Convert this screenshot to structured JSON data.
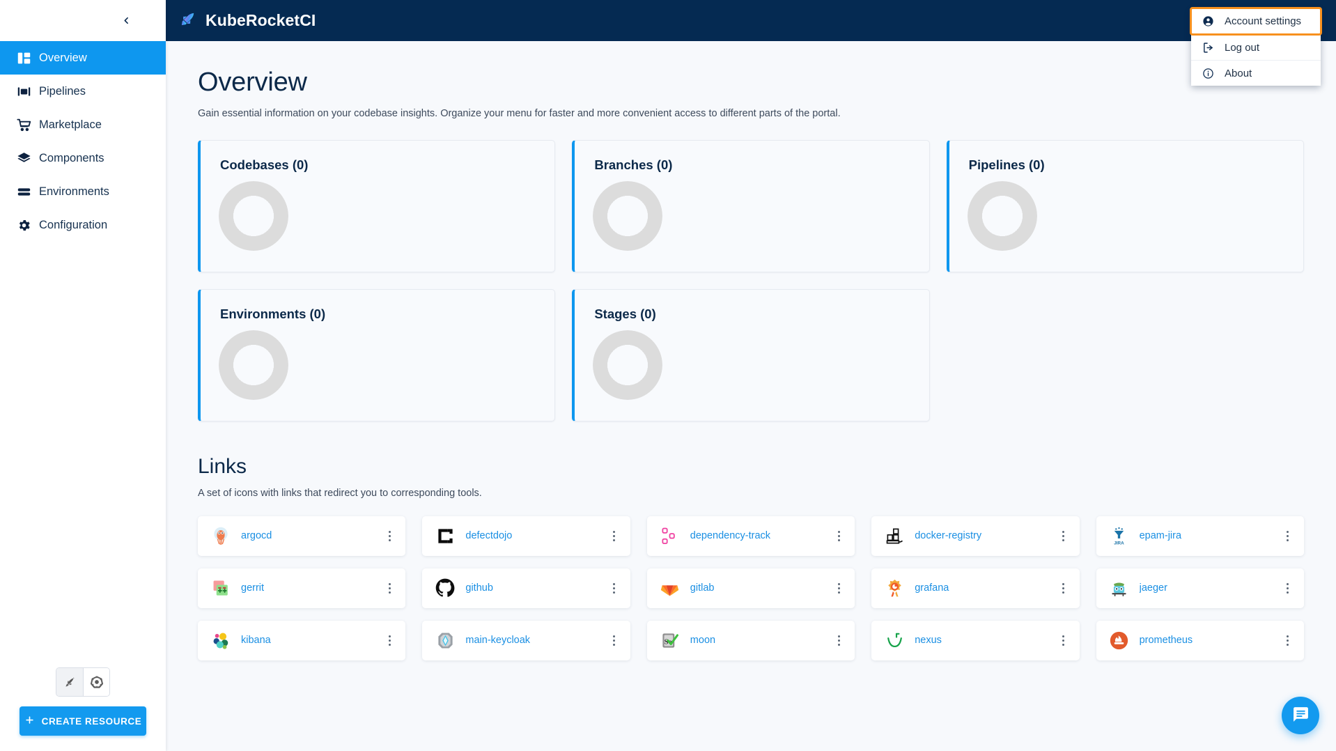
{
  "sidebar": {
    "collapse_icon": "chevron-left-icon",
    "items": [
      {
        "label": "Overview",
        "icon": "dashboard-icon",
        "active": true
      },
      {
        "label": "Pipelines",
        "icon": "pipelines-icon",
        "active": false
      },
      {
        "label": "Marketplace",
        "icon": "cart-icon",
        "active": false
      },
      {
        "label": "Components",
        "icon": "layers-icon",
        "active": false
      },
      {
        "label": "Environments",
        "icon": "stack-icon",
        "active": false
      },
      {
        "label": "Configuration",
        "icon": "gear-icon",
        "active": false
      }
    ],
    "mode_toggle": [
      {
        "icon": "rocket-icon",
        "selected": true
      },
      {
        "icon": "kubernetes-icon",
        "selected": false
      }
    ],
    "create_button": {
      "label": "CREATE RESOURCE",
      "icon": "plus-icon"
    }
  },
  "topbar": {
    "brand": "KubeRocketCI",
    "brand_icon": "rocket-feather-logo",
    "account_menu": [
      {
        "label": "Account settings",
        "icon": "account-circle-icon",
        "highlighted": true
      },
      {
        "label": "Log out",
        "icon": "logout-icon",
        "highlighted": false
      },
      {
        "label": "About",
        "icon": "info-icon",
        "highlighted": false
      }
    ]
  },
  "main": {
    "title": "Overview",
    "subtitle": "Gain essential information on your codebase insights. Organize your menu for faster and more convenient access to different parts of the portal.",
    "stat_cards": [
      {
        "title": "Codebases (0)",
        "count": 0
      },
      {
        "title": "Branches (0)",
        "count": 0
      },
      {
        "title": "Pipelines (0)",
        "count": 0
      },
      {
        "title": "Environments (0)",
        "count": 0
      },
      {
        "title": "Stages (0)",
        "count": 0
      }
    ],
    "links_section": {
      "title": "Links",
      "subtitle": "A set of icons with links that redirect you to corresponding tools.",
      "kebab_icon": "more-vertical-icon",
      "items": [
        {
          "label": "argocd",
          "icon": "argocd-icon"
        },
        {
          "label": "defectdojo",
          "icon": "defectdojo-icon"
        },
        {
          "label": "dependency-track",
          "icon": "dependency-track-icon"
        },
        {
          "label": "docker-registry",
          "icon": "docker-registry-icon"
        },
        {
          "label": "epam-jira",
          "icon": "jira-icon"
        },
        {
          "label": "gerrit",
          "icon": "gerrit-icon"
        },
        {
          "label": "github",
          "icon": "github-icon"
        },
        {
          "label": "gitlab",
          "icon": "gitlab-icon"
        },
        {
          "label": "grafana",
          "icon": "grafana-icon"
        },
        {
          "label": "jaeger",
          "icon": "jaeger-icon"
        },
        {
          "label": "kibana",
          "icon": "kibana-icon"
        },
        {
          "label": "main-keycloak",
          "icon": "keycloak-icon"
        },
        {
          "label": "moon",
          "icon": "selenium-moon-icon"
        },
        {
          "label": "nexus",
          "icon": "nexus-icon"
        },
        {
          "label": "prometheus",
          "icon": "prometheus-icon"
        }
      ]
    },
    "chat_fab": {
      "icon": "chat-icon"
    }
  },
  "colors": {
    "accent_blue": "#0e97ef",
    "topbar_navy": "#052a52",
    "highlight_orange": "#f7901e",
    "link_blue": "#1a8fe3",
    "content_bg": "#f7f9fc",
    "donut_gray": "#dcdcdc"
  }
}
